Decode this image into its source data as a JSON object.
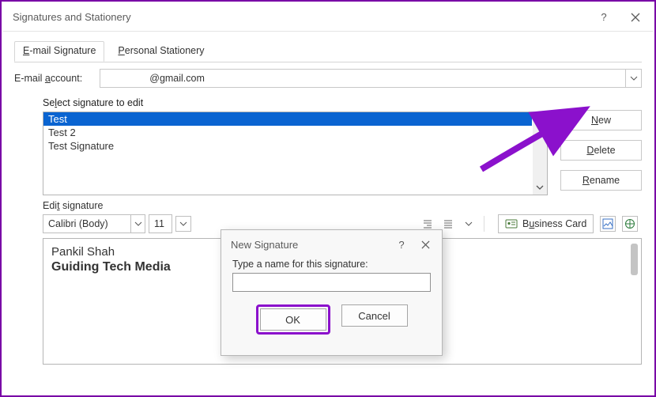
{
  "window": {
    "title": "Signatures and Stationery"
  },
  "tabs": {
    "email_u": "E",
    "email_rest": "-mail Signature",
    "personal_u": "P",
    "personal_rest": "ersonal Stationery"
  },
  "account": {
    "label_pre": "E-mail ",
    "label_u": "a",
    "label_post": "ccount:",
    "value": "@gmail.com"
  },
  "siglist": {
    "label_pre": "Se",
    "label_u": "l",
    "label_post": "ect signature to edit",
    "items": [
      "Test",
      "Test 2",
      "Test Signature"
    ],
    "selected_index": 0
  },
  "buttons": {
    "new": "New",
    "new_u": "N",
    "delete": "Delete",
    "delete_u": "D",
    "rename": "Rename",
    "rename_u": "R"
  },
  "editbar": {
    "label_pre": "Edi",
    "label_u": "t",
    "label_post": " signature",
    "font": "Calibri (Body)",
    "size": "11",
    "bizcard_pre": "B",
    "bizcard_u": "u",
    "bizcard_post": "siness Card"
  },
  "editor": {
    "line1": "Pankil Shah",
    "line2": "Guiding Tech Media"
  },
  "modal": {
    "title": "New Signature",
    "prompt": "Type a name for this signature:",
    "ok": "OK",
    "cancel": "Cancel"
  }
}
